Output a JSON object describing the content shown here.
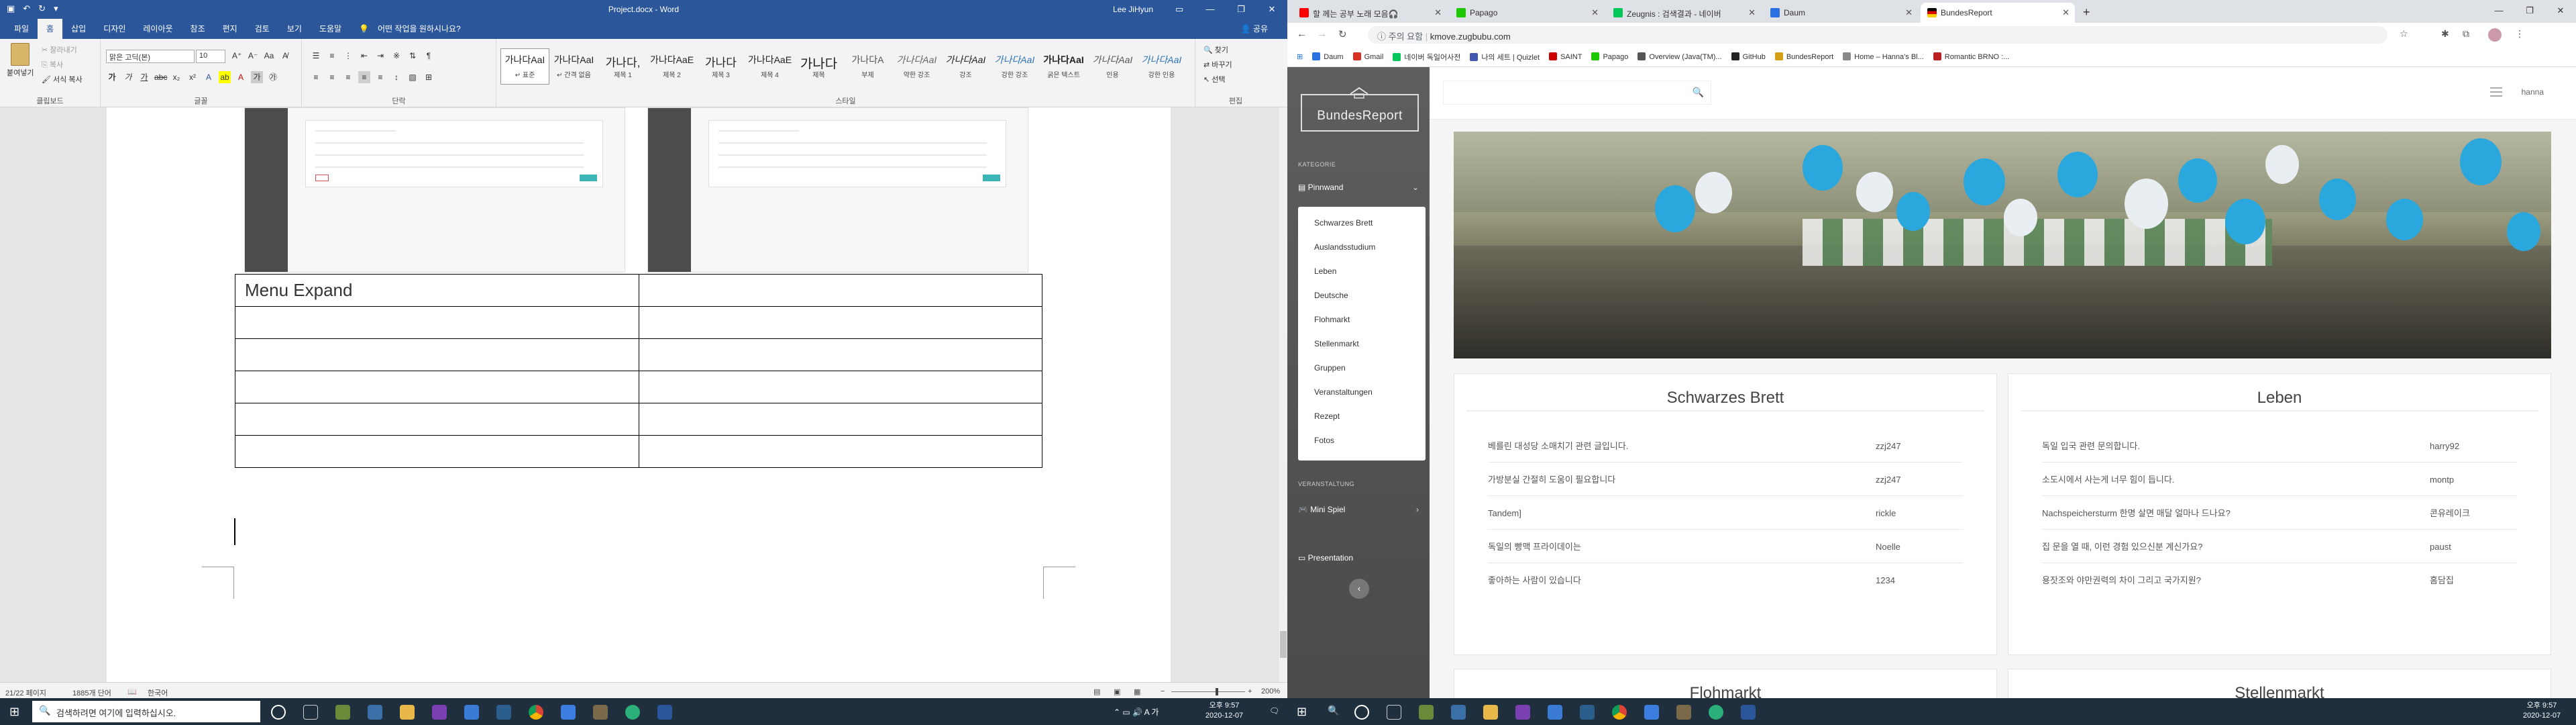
{
  "word": {
    "title": "Project.docx - Word",
    "user": "Lee JiHyun",
    "tabs": [
      "파일",
      "홈",
      "삽입",
      "디자인",
      "레이아웃",
      "참조",
      "편지",
      "검토",
      "보기",
      "도움말"
    ],
    "tell_me": "어떤 작업을 원하시나요?",
    "share": "공유",
    "clipboard": {
      "paste": "붙여넣기",
      "cut": "잘라내기",
      "copy": "복사",
      "format_painter": "서식 복사",
      "group": "클립보드"
    },
    "font": {
      "name": "맑은 고딕(본)",
      "size": "10",
      "group": "글꼴"
    },
    "paragraph_group": "단락",
    "styles_group": "스타일",
    "styles": [
      {
        "sample": "가나다AaI",
        "name": "↵ 표준"
      },
      {
        "sample": "가나다AaI",
        "name": "↵ 간격 없음"
      },
      {
        "sample": "가나다,",
        "name": "제목 1"
      },
      {
        "sample": "가나다AaE",
        "name": "제목 2"
      },
      {
        "sample": "가나다",
        "name": "제목 3"
      },
      {
        "sample": "가나다AaE",
        "name": "제목 4"
      },
      {
        "sample": "가나다",
        "name": "제목"
      },
      {
        "sample": "가나다A",
        "name": "부제"
      },
      {
        "sample": "가나다AaI",
        "name": "약한 강조"
      },
      {
        "sample": "가나다AaI",
        "name": "강조"
      },
      {
        "sample": "가나다AaI",
        "name": "강한 강조"
      },
      {
        "sample": "가나다AaI",
        "name": "굵은 텍스트"
      },
      {
        "sample": "가나다AaI",
        "name": "인용"
      },
      {
        "sample": "가나다AaI",
        "name": "강한 인용"
      }
    ],
    "editing": {
      "find": "찾기",
      "replace": "바꾸기",
      "select": "선택",
      "group": "편집"
    },
    "table_heading": "Menu Expand",
    "status": {
      "page": "21/22 페이지",
      "words": "1885개 단어",
      "lang": "한국어",
      "zoom": "200%"
    }
  },
  "chrome": {
    "tabs": [
      {
        "title": "할 께는 공부 노래 모음🎧",
        "color": "#ff0000"
      },
      {
        "title": "Papago",
        "color": "#1ec800"
      },
      {
        "title": "Zeugnis : 검색결과 - 네이버",
        "color": "#03c75a"
      },
      {
        "title": "Daum",
        "color": "#2b6fe0"
      },
      {
        "title": "BundesReport",
        "color": "#d4a017"
      }
    ],
    "address_insecure": "주의 요함",
    "url": "kmove.zugbubu.com",
    "bookmarks": [
      {
        "label": "Daum",
        "color": "#2b6fe0"
      },
      {
        "label": "Gmail",
        "color": "#d93025"
      },
      {
        "label": "네이버 독일어사전",
        "color": "#03c75a"
      },
      {
        "label": "나의 세트 | Quizlet",
        "color": "#4257b2"
      },
      {
        "label": "SAINT",
        "color": "#c00"
      },
      {
        "label": "Papago",
        "color": "#1ec800"
      },
      {
        "label": "Overview (Java(TM)...",
        "color": "#555"
      },
      {
        "label": "GitHub",
        "color": "#222"
      },
      {
        "label": "BundesReport",
        "color": "#d4a017"
      },
      {
        "label": "Home – Hanna's Bl...",
        "color": "#888"
      },
      {
        "label": "Romantic BRNO :...",
        "color": "#b22"
      }
    ],
    "bundes": {
      "logo": "BundesReport",
      "user": "hanna",
      "section_category": "KATEGORIE",
      "menu_main": "Pinnwand",
      "submenu": [
        "Schwarzes Brett",
        "Auslandsstudium",
        "Leben",
        "Deutsche",
        "Flohmarkt",
        "Stellenmarkt",
        "Gruppen",
        "Veranstaltungen",
        "Rezept",
        "Fotos"
      ],
      "section_event": "VERANSTALTUNG",
      "mini_spiel": "Mini Spiel",
      "presentation": "Presentation",
      "boards": [
        {
          "title": "Schwarzes Brett",
          "rows": [
            {
              "text": "베를린 대성당 소매치기 관련 글입니다.",
              "author": "zzj247"
            },
            {
              "text": "가방분실 간절히 도움이 필요합니다",
              "author": "zzj247"
            },
            {
              "text": "Tandem]",
              "author": "rickle"
            },
            {
              "text": "독일의 빵맥 프라이데이는",
              "author": "Noelle"
            },
            {
              "text": "좋아하는 사람이 있습니다",
              "author": "1234"
            }
          ]
        },
        {
          "title": "Leben",
          "rows": [
            {
              "text": "독일 입국 관련 문의합니다.",
              "author": "harry92"
            },
            {
              "text": "소도시에서 사는게 너무 힘이 듭니다.",
              "author": "montp"
            },
            {
              "text": "Nachspeichersturm 한명 살면 매달 얼마나 드나요?",
              "author": "콘유레이크"
            },
            {
              "text": "집 문을 열 때, 이런 경험 있으신분 계신가요?",
              "author": "paust"
            },
            {
              "text": "용잣조와 야만권력의 차이 그리고 국가지원?",
              "author": "홈담집"
            }
          ]
        },
        {
          "title": "Flohmarkt",
          "rows": []
        },
        {
          "title": "Stellenmarkt",
          "rows": []
        }
      ]
    }
  },
  "taskbar": {
    "search_placeholder": "검색하려면 여기에 입력하십시오.",
    "time": "오후 9:57",
    "date": "2020-12-07"
  }
}
